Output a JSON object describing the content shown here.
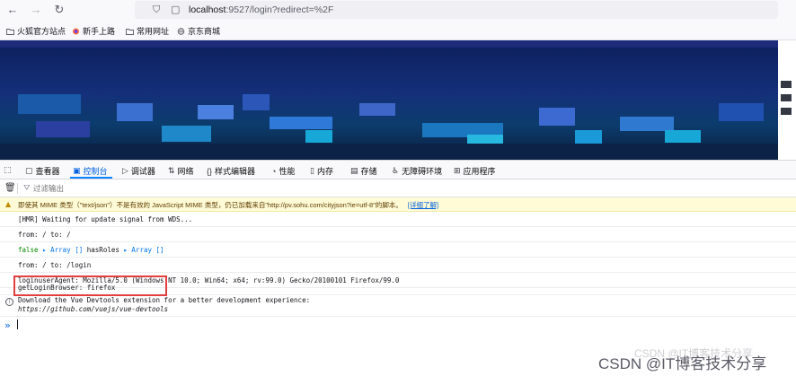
{
  "browser": {
    "url_host": "localhost",
    "url_rest": ":9527/login?redirect=%2F"
  },
  "bookmarks": [
    {
      "label": "火狐官方站点",
      "icon": "folder-icon"
    },
    {
      "label": "新手上路",
      "icon": "firefox-icon"
    },
    {
      "label": "常用网址",
      "icon": "folder-icon"
    },
    {
      "label": "京东商城",
      "icon": "globe-icon"
    }
  ],
  "devtools": {
    "tabs": [
      {
        "label": "查看器",
        "icon": "inspector-icon"
      },
      {
        "label": "控制台",
        "icon": "console-icon",
        "active": true
      },
      {
        "label": "调试器",
        "icon": "debugger-icon"
      },
      {
        "label": "网络",
        "icon": "network-icon"
      },
      {
        "label": "样式编辑器",
        "icon": "style-editor-icon"
      },
      {
        "label": "性能",
        "icon": "performance-icon"
      },
      {
        "label": "内存",
        "icon": "memory-icon"
      },
      {
        "label": "存储",
        "icon": "storage-icon"
      },
      {
        "label": "无障碍环境",
        "icon": "accessibility-icon"
      },
      {
        "label": "应用程序",
        "icon": "application-icon"
      }
    ],
    "filter_placeholder": "过滤输出"
  },
  "console": {
    "warning": "即使其 MIME 类型（\"text/json\"）不是有效的 JavaScript MIME 类型，仍已加载来自\"http://pv.sohu.com/cityjson?ie=utf-8\"的脚本。",
    "warning_link": "[详细了解]",
    "hmr": "[HMR] Waiting for update signal from WDS...",
    "from1": "from: / to: /",
    "roles_false": "false",
    "roles_array1": "▸ Array []",
    "roles_mid": "hasRoles",
    "roles_array2": "▸ Array []",
    "from2": "from: / to: /login",
    "useragent": "loginuserAgent: Mozilla/5.0 (Windows NT 10.0; Win64; x64; rv:99.0) Gecko/20100101 Firefox/99.0",
    "browser_line": "getLoginBrowser: firefox",
    "vue_line1": "Download the Vue Devtools extension for a better development experience:",
    "vue_line2": "https://github.com/vuejs/vue-devtools",
    "prompt": "»"
  },
  "watermark": {
    "ghost": "CSDN @IT博客技术分享",
    "main": "CSDN @IT博客技术分享"
  },
  "colors": {
    "active_tab": "#0060df",
    "warning_bg": "#fffbd6",
    "highlight": "#e33d3d",
    "banner": "#14307a"
  }
}
